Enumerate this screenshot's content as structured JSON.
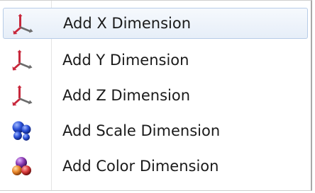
{
  "menu": {
    "items": [
      {
        "label": "Add X Dimension",
        "icon": "axis-icon",
        "highlighted": true
      },
      {
        "label": "Add Y Dimension",
        "icon": "axis-icon"
      },
      {
        "label": "Add Z Dimension",
        "icon": "axis-icon"
      },
      {
        "label": "Add Scale Dimension",
        "icon": "scale-spheres-icon"
      },
      {
        "label": "Add Color Dimension",
        "icon": "color-spheres-icon"
      }
    ]
  },
  "colors": {
    "highlight_border": "#b7cce7",
    "axis_red": "#c8283c",
    "axis_gray": "#6c6c6c",
    "scale_blue": "#2a4fd6",
    "color_purple": "#8a3ab2",
    "color_orange": "#e8862a",
    "color_red": "#d83a3a"
  }
}
